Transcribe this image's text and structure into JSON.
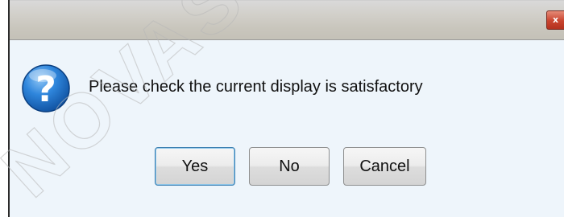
{
  "dialog": {
    "close_glyph": "x",
    "message": "Please check the current display is satisfactory",
    "icon": "question-icon",
    "buttons": {
      "yes": "Yes",
      "no": "No",
      "cancel": "Cancel"
    }
  },
  "watermark": {
    "text": "NOVASTAR"
  },
  "colors": {
    "icon_blue": "#1f6fc6",
    "default_button_border": "#3c7fb1",
    "close_button": "#c9442f",
    "dialog_background": "#eef5fb"
  }
}
